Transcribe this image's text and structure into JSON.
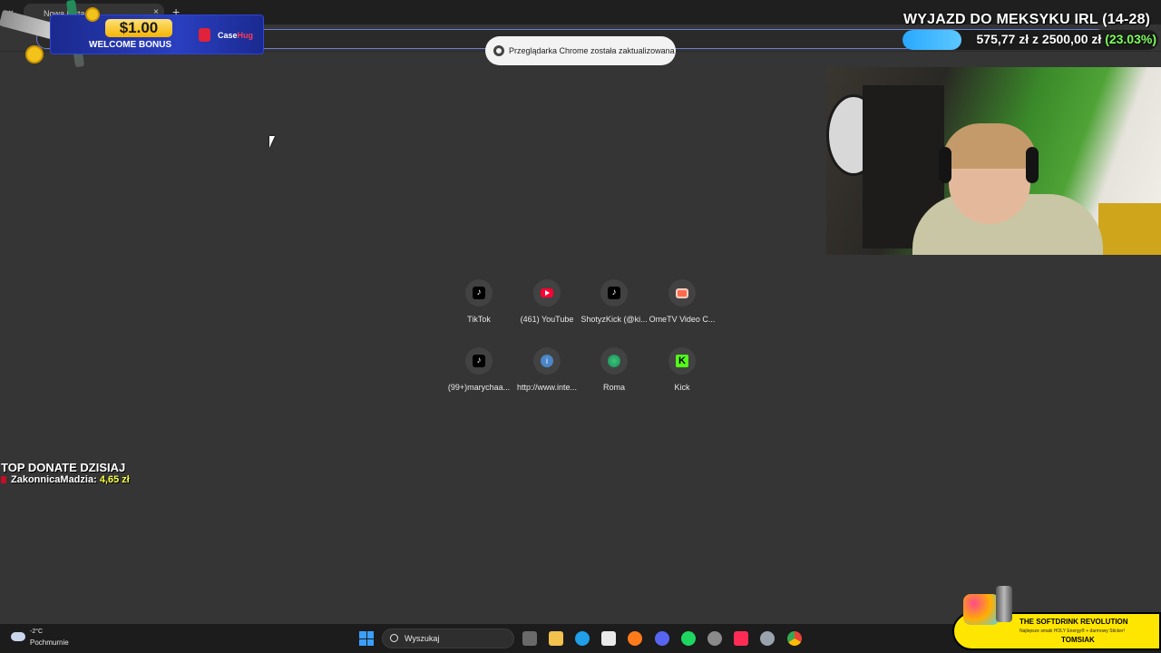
{
  "browser": {
    "tab_title": "Nowa karta",
    "new_tab_label": "+",
    "close_label": "×",
    "tab_list_label": "⌄"
  },
  "toast": {
    "text": "Przeglądarka Chrome została zaktualizowana"
  },
  "bonus": {
    "amount": "$1.00",
    "text": "WELCOME BONUS",
    "brand_prefix": "Case",
    "brand_suffix": "Hug"
  },
  "goal": {
    "title": "WYJAZD DO MEKSYKU IRL (14-28)",
    "current": "575,77 zł",
    "separator": "z",
    "target": "2500,00 zł",
    "percent": "(23.03%)",
    "progress": 0.2303
  },
  "shortcuts": [
    {
      "label": "TikTok",
      "icon": "tiktok-icon"
    },
    {
      "label": "(461) YouTube",
      "icon": "youtube-icon"
    },
    {
      "label": "ShotyzKick (@ki...",
      "icon": "tiktok-icon"
    },
    {
      "label": "OmeTV Video C...",
      "icon": "ometv-icon"
    },
    {
      "label": "(99+)marychaa...",
      "icon": "tiktok-icon"
    },
    {
      "label": "http://www.inte...",
      "icon": "info-icon",
      "glyph": "i"
    },
    {
      "label": "Roma",
      "icon": "globe-icon"
    },
    {
      "label": "Kick",
      "icon": "kick-icon",
      "glyph": "K"
    }
  ],
  "donate": {
    "title": "TOP DONATE DZISIAJ",
    "name": "ZakonnicaMadzia:",
    "amount": "4,65 zł"
  },
  "taskbar": {
    "temperature": "-2°C",
    "condition": "Pochmurnie",
    "search_placeholder": "Wyszukaj"
  },
  "ad": {
    "headline": "THE SOFTDRINK REVOLUTION",
    "subline": "Najlepsze smaki HOLY Energy® + darmowy Sticker!",
    "code": "TOMSIAK"
  },
  "colors": {
    "accent": "#29a8ff",
    "goal_pct": "#7dff5a",
    "donate_amount": "#f6ff3c",
    "kick": "#53fc18"
  }
}
